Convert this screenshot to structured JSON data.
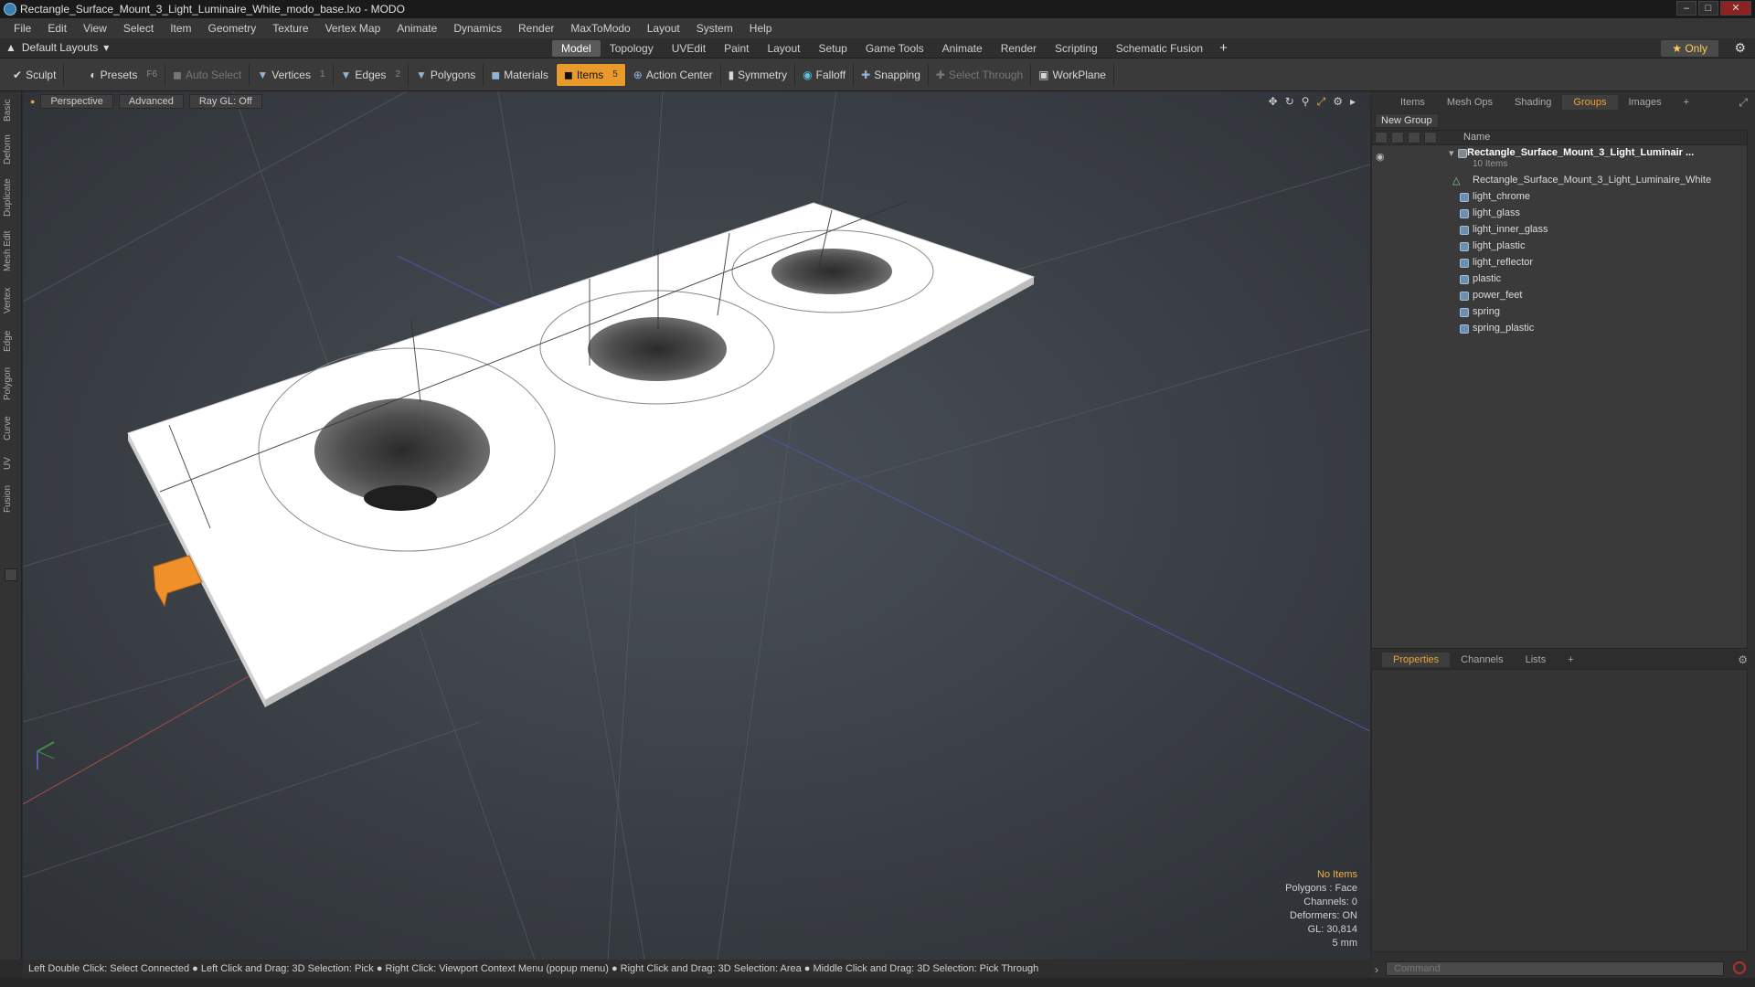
{
  "window": {
    "title": "Rectangle_Surface_Mount_3_Light_Luminaire_White_modo_base.lxo - MODO",
    "min": "–",
    "max": "□",
    "close": "✕"
  },
  "menu": [
    "File",
    "Edit",
    "View",
    "Select",
    "Item",
    "Geometry",
    "Texture",
    "Vertex Map",
    "Animate",
    "Dynamics",
    "Render",
    "MaxToModo",
    "Layout",
    "System",
    "Help"
  ],
  "layout": {
    "selector": "Default Layouts",
    "tabs": [
      "Model",
      "Topology",
      "UVEdit",
      "Paint",
      "Layout",
      "Setup",
      "Game Tools",
      "Animate",
      "Render",
      "Scripting",
      "Schematic Fusion"
    ],
    "active_tab": "Model",
    "plus": "+",
    "only": "★ Only"
  },
  "toolbar": {
    "sculpt": "Sculpt",
    "presets": "Presets",
    "presets_key": "F6",
    "auto_select": "Auto Select",
    "vertices": "Vertices",
    "vertices_count": "1",
    "edges": "Edges",
    "edges_count": "2",
    "polygons": "Polygons",
    "materials": "Materials",
    "items": "Items",
    "items_count": "5",
    "action_center": "Action Center",
    "symmetry": "Symmetry",
    "falloff": "Falloff",
    "snapping": "Snapping",
    "select_through": "Select Through",
    "workplane": "WorkPlane"
  },
  "left_tabs": [
    "Basic",
    "Deform",
    "Duplicate",
    "Mesh Edit",
    "Vertex",
    "Edge",
    "Polygon",
    "Curve",
    "UV",
    "Fusion"
  ],
  "viewport": {
    "view": "Perspective",
    "mode": "Advanced",
    "raygl": "Ray GL: Off",
    "info": {
      "selection": "No Items",
      "polygons": "Polygons : Face",
      "channels": "Channels: 0",
      "deformers": "Deformers: ON",
      "gl": "GL: 30,814",
      "unit": "5 mm"
    }
  },
  "statusbar": "Left Double Click: Select Connected ● Left Click and Drag: 3D Selection: Pick ● Right Click: Viewport Context Menu (popup menu) ● Right Click and Drag: 3D Selection: Area ● Middle Click and Drag: 3D Selection: Pick Through",
  "panel": {
    "tabs": [
      "Items",
      "Mesh Ops",
      "Shading",
      "Groups",
      "Images"
    ],
    "active_tab": "Groups",
    "new_group": "New Group",
    "col_name": "Name",
    "root": "Rectangle_Surface_Mount_3_Light_Luminair ...",
    "root_count": "10 Items",
    "mesh_item": "Rectangle_Surface_Mount_3_Light_Luminaire_White",
    "materials": [
      "light_chrome",
      "light_glass",
      "light_inner_glass",
      "light_plastic",
      "light_reflector",
      "plastic",
      "power_feet",
      "spring",
      "spring_plastic"
    ],
    "bottom_tabs": [
      "Properties",
      "Channels",
      "Lists"
    ],
    "bottom_active": "Properties",
    "command_placeholder": "Command"
  },
  "colors": {
    "accent": "#e89b2a",
    "viewport_bg": "#3a3f44",
    "model_white": "#ffffff",
    "handle_orange": "#f0902a"
  }
}
